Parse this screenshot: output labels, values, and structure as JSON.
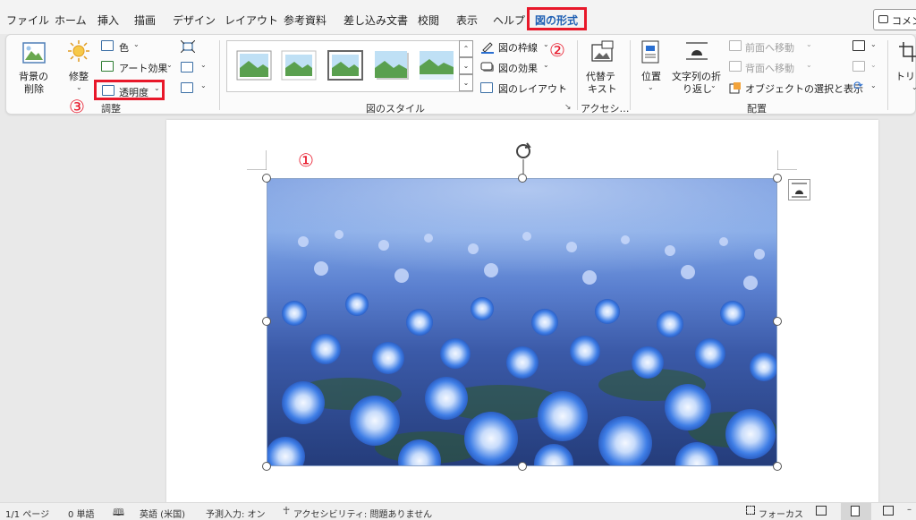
{
  "menu": {
    "tabs": [
      "ファイル",
      "ホーム",
      "挿入",
      "描画",
      "デザイン",
      "レイアウト",
      "参考資料",
      "差し込み文書",
      "校閲",
      "表示",
      "ヘルプ",
      "図の形式"
    ],
    "active_tab": "図の形式",
    "comment_label": "コメント"
  },
  "ribbon": {
    "adjust": {
      "remove_bg_line1": "背景の",
      "remove_bg_line2": "削除",
      "corrections": "修整",
      "color": "色",
      "artistic": "アート効果",
      "transparency": "透明度",
      "group_label": "調整"
    },
    "styles": {
      "border": "図の枠線",
      "effects": "図の効果",
      "layout": "図のレイアウト",
      "group_label": "図のスタイル"
    },
    "accessibility": {
      "alt_text_line1": "代替テ",
      "alt_text_line2": "キスト",
      "group_label": "アクセシ…"
    },
    "arrange": {
      "position": "位置",
      "wrap_line1": "文字列の折",
      "wrap_line2": "り返し",
      "bring_forward": "前面へ移動",
      "send_backward": "背面へ移動",
      "selection_pane": "オブジェクトの選択と表示",
      "group_label": "配置"
    },
    "size": {
      "crop_label": "トリミ"
    }
  },
  "annotations": {
    "one": "①",
    "two": "②",
    "three": "③"
  },
  "colors": {
    "accent_red": "#e8182a",
    "active_tab_text": "#1f5fb3"
  },
  "statusbar": {
    "page": "1/1 ページ",
    "words": "0 単語",
    "language": "英語 (米国)",
    "prediction": "予測入力: オン",
    "accessibility": "アクセシビリティ: 問題ありません",
    "focus": "フォーカス"
  }
}
